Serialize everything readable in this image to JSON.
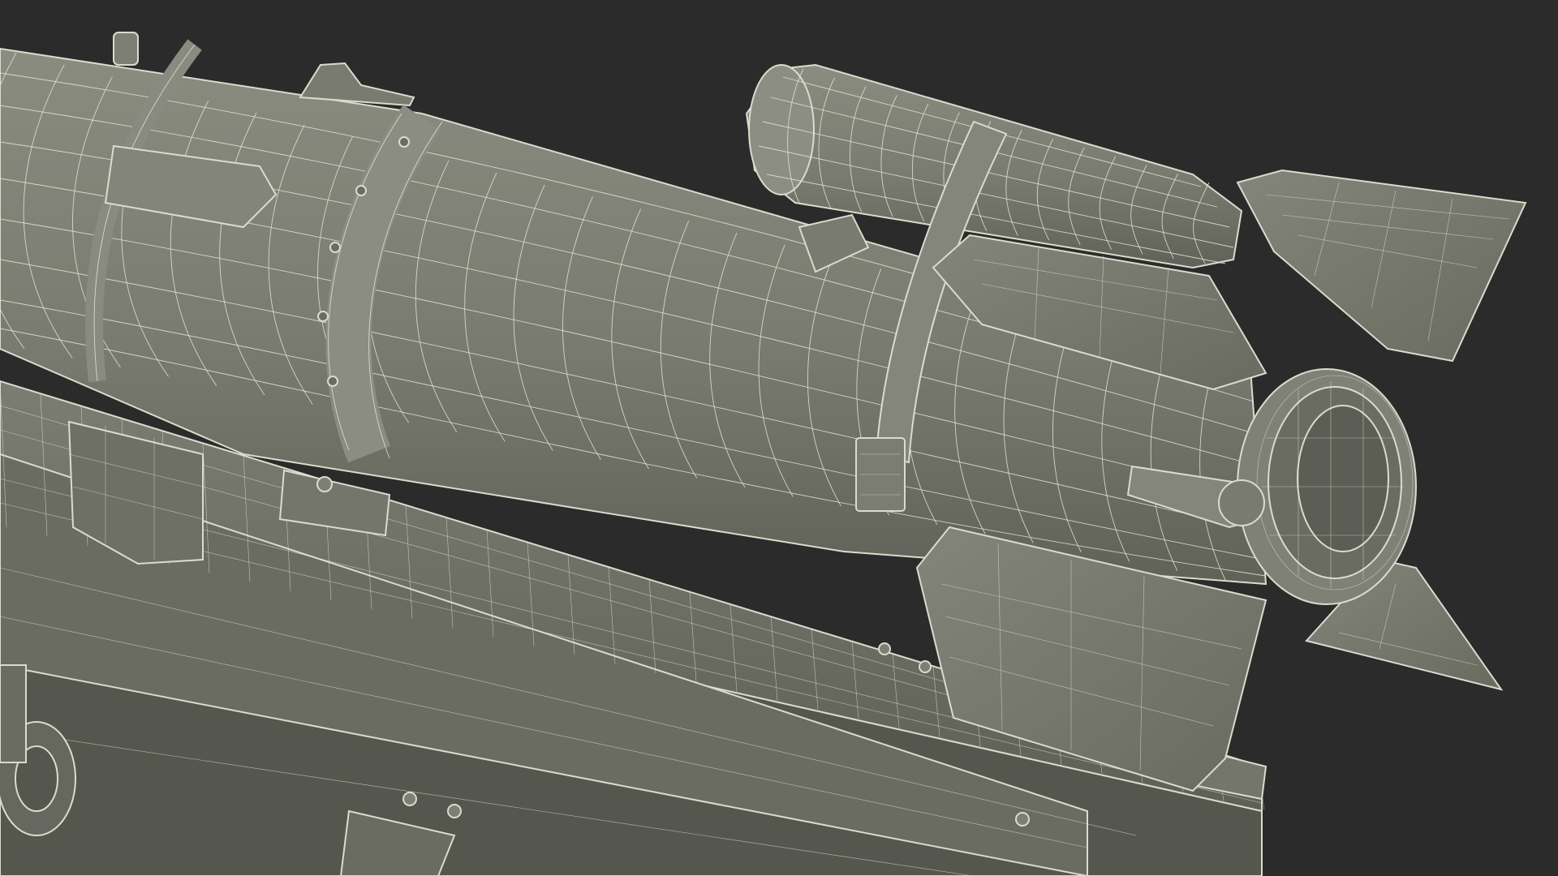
{
  "scene": {
    "subject": "rocket-on-launch-rail",
    "render_style": "wireframe-over-shaded",
    "colors": {
      "background": "#2b2b2b",
      "surface": "#7a7b70",
      "surface_light": "#8b8c80",
      "surface_dark": "#5f6058",
      "wire": "#e4e6d8"
    }
  }
}
